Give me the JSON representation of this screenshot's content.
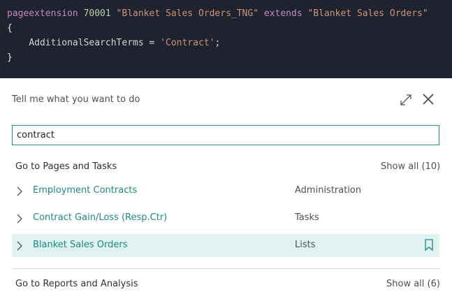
{
  "code": {
    "line1": {
      "kw1": "pageextension",
      "num": "70001",
      "str1": "\"Blanket Sales Orders_TNG\"",
      "kw2": "extends",
      "str2": "\"Blanket Sales Orders\""
    },
    "line2": "{",
    "line3": {
      "ident": "AdditionalSearchTerms",
      "op": " = ",
      "val": "'Contract'",
      "end": ";"
    },
    "line4": "}"
  },
  "panel": {
    "title": "Tell me what you want to do",
    "search_value": "contract"
  },
  "pages_section": {
    "header": "Go to Pages and Tasks",
    "show_all": "Show all (10)",
    "items": [
      {
        "name": "Employment Contracts",
        "category": "Administration"
      },
      {
        "name": "Contract Gain/Loss (Resp.Ctr)",
        "category": "Tasks"
      },
      {
        "name": "Blanket Sales Orders",
        "category": "Lists"
      }
    ]
  },
  "reports_section": {
    "header": "Go to Reports and Analysis",
    "show_all": "Show all (6)"
  },
  "colors": {
    "accent": "#1b8a82",
    "highlight": "#dff1f1",
    "code_bg": "#1f2330"
  },
  "icons": [
    "expand-icon",
    "close-icon",
    "chevron-right-icon",
    "bookmark-icon"
  ]
}
